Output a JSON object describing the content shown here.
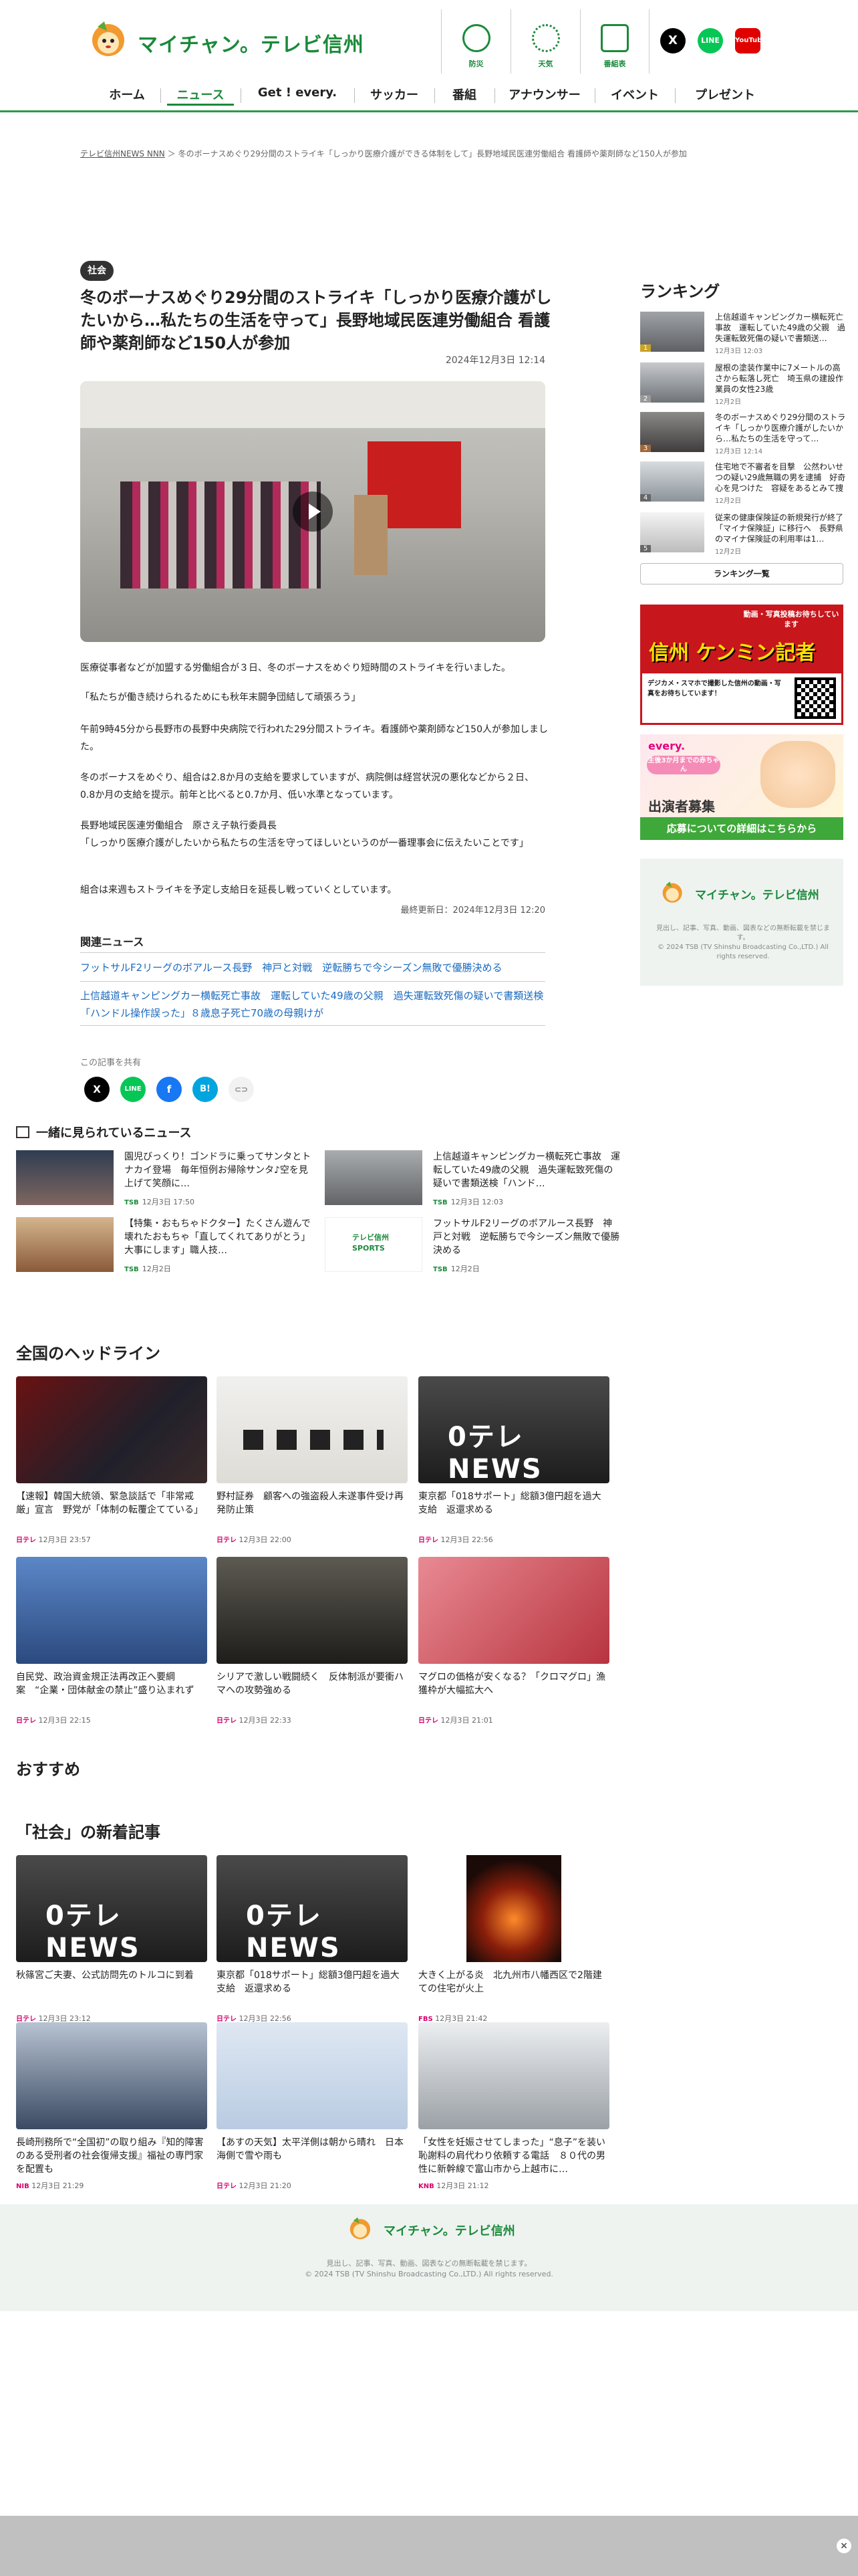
{
  "header": {
    "logo_text": "マイチャン。テレビ信州",
    "icon_buttons": [
      {
        "label": "防災",
        "icon": "umbrella-icon"
      },
      {
        "label": "天気",
        "icon": "sun-icon"
      },
      {
        "label": "番組表",
        "icon": "grid-icon"
      }
    ],
    "social": [
      {
        "label": "X",
        "icon": "x-icon",
        "color": "#000000"
      },
      {
        "label": "LINE",
        "icon": "line-icon",
        "color": "#06c755"
      },
      {
        "label": "YouTube",
        "icon": "youtube-icon",
        "color": "#e00000"
      }
    ],
    "nav": [
      "ホーム",
      "ニュース",
      "Get ! every.",
      "サッカー",
      "番組",
      "アナウンサー",
      "イベント",
      "プレゼント"
    ],
    "nav_active": "ニュース",
    "brand_color": "#1a8a3a"
  },
  "breadcrumb": {
    "home": "テレビ信州NEWS NNN",
    "sep": "＞",
    "current": "冬のボーナスめぐり29分間のストライキ「しっかり医療介護ができる体制をして」長野地域民医連労働組合 看護師や薬剤師など150人が参加"
  },
  "article": {
    "category": "社会",
    "title": "冬のボーナスめぐり29分間のストライキ「しっかり医療介護がしたいから…私たちの生活を守って」長野地域民医連労働組合 看護師や薬剤師など150人が参加",
    "date": "2024年12月3日 12:14",
    "paragraphs": [
      "医療従事者などが加盟する労働組合が３日、冬のボーナスをめぐり短時間のストライキを行いました。",
      "「私たちが働き続けられるためにも秋年末闘争団結して頑張ろう」",
      "午前9時45分から長野市の長野中央病院で行われた29分間ストライキ。看護師や薬剤師など150人が参加しました。",
      "冬のボーナスをめぐり、組合は2.8か月の支給を要求していますが、病院側は経営状況の悪化などから２日、0.8か月の支給を提示。前年と比べると0.7か月、低い水準となっています。",
      "長野地域民医連労働組合　原さえ子執行委員長\n「しっかり医療介護がしたいから私たちの生活を守ってほしいというのが一番理事会に伝えたいことです」",
      "組合は来週もストライキを予定し支給日を延長し戦っていくとしています。"
    ],
    "updated": "最終更新日：2024年12月3日 12:20",
    "related_title": "関連ニュース",
    "related": [
      "フットサルF2リーグのボアルース長野　神戸と対戦　逆転勝ちで今シーズン無敗で優勝決める",
      "上信越道キャンピングカー横転死亡事故　運転していた49歳の父親　過失運転致死傷の疑いで書類送検「ハンドル操作誤った」８歳息子死亡70歳の母親けが"
    ],
    "share_title": "この記事を共有",
    "share": [
      {
        "label": "X",
        "icon": "x-icon",
        "color": "#000000"
      },
      {
        "label": "LINE",
        "icon": "line-icon",
        "color": "#06c755"
      },
      {
        "label": "f",
        "icon": "facebook-icon",
        "color": "#1877f2"
      },
      {
        "label": "B!",
        "icon": "hatena-icon",
        "color": "#00a4de"
      },
      {
        "label": "⊂⊃",
        "icon": "link-icon",
        "color": "#bbbbbb"
      }
    ]
  },
  "seen_together": {
    "title": "一緒に見られているニュース",
    "items": [
      {
        "title": "園児びっくり！ゴンドラに乗ってサンタとトナカイ登場　毎年恒例お帰除サンタ♪空を見上げて笑顔に…",
        "source": "TSB",
        "time": "12月3日 17:50"
      },
      {
        "title": "上信越道キャンピングカー横転死亡事故　運転していた49歳の父親　過失運転致死傷の疑いで書類送検「ハンド…",
        "source": "TSB",
        "time": "12月3日 12:03"
      },
      {
        "title": "【特集・おもちゃドクター】たくさん遊んで壊れたおもちゃ「直してくれてありがとう」大事にします」職人技…",
        "source": "TSB",
        "time": "12月2日"
      },
      {
        "title": "フットサルF2リーグのボアルース長野　神戸と対戦　逆転勝ちで今シーズン無敗で優勝決める",
        "source": "TSB",
        "time": "12月2日"
      }
    ]
  },
  "national": {
    "title": "全国のヘッドライン",
    "items": [
      {
        "title": "【速報】韓国大統領、緊急談話で「非常戒厳」宣言　野党が「体制の転覆企てている」",
        "source": "日テレ",
        "time": "12月3日 23:57",
        "thumb": "photo"
      },
      {
        "title": "野村証券　顧客への強盗殺人未遂事件受け再発防止策",
        "source": "日テレ",
        "time": "12月3日 22:00",
        "thumb": "photo"
      },
      {
        "title": "東京都「018サポート」総額3億円超を過大支給　返還求める",
        "source": "日テレ",
        "time": "12月3日 22:56",
        "thumb": "ntv"
      },
      {
        "title": "自民党、政治資金規正法再改正へ要綱案　“企業・団体献金の禁止”盛り込まれず",
        "source": "日テレ",
        "time": "12月3日 22:15",
        "thumb": "photo"
      },
      {
        "title": "シリアで激しい戦闘続く　反体制派が要衝ハマへの攻勢強める",
        "source": "日テレ",
        "time": "12月3日 22:33",
        "thumb": "photo"
      },
      {
        "title": "マグロの価格が安くなる？「クロマグロ」漁獲枠が大幅拡大へ",
        "source": "日テレ",
        "time": "12月3日 21:01",
        "thumb": "photo"
      }
    ]
  },
  "recommend": {
    "title": "おすすめ"
  },
  "social_news": {
    "title": "「社会」の新着記事",
    "items": [
      {
        "title": "秋篠宮ご夫妻、公式訪問先のトルコに到着",
        "source": "日テレ",
        "time": "12月3日 23:12",
        "thumb": "ntv"
      },
      {
        "title": "東京都「018サポート」総額3億円超を過大支給　返還求める",
        "source": "日テレ",
        "time": "12月3日 22:56",
        "thumb": "ntv"
      },
      {
        "title": "大きく上がる炎　北九州市八幡西区で2階建ての住宅が火上",
        "source": "FBS",
        "time": "12月3日 21:42",
        "thumb": "photo"
      },
      {
        "title": "長崎刑務所で“全国初”の取り組み『知的障害のある受刑者の社会復帰支援』福祉の専門家を配置も",
        "source": "NIB",
        "time": "12月3日 21:29",
        "thumb": "photo"
      },
      {
        "title": "【あすの天気】太平洋側は朝から晴れ　日本海側で雪や雨も",
        "source": "日テレ",
        "time": "12月3日 21:20",
        "thumb": "photo"
      },
      {
        "title": "「女性を妊娠させてしまった」“息子”を装い恥謝料の肩代わり依頼する電話　８０代の男性に新幹線で富山市から上越市に…",
        "source": "KNB",
        "time": "12月3日 21:12",
        "thumb": "photo"
      }
    ]
  },
  "ranking": {
    "title": "ランキング",
    "items": [
      {
        "rank": "1",
        "title": "上信越道キャンピングカー横転死亡事故　運転していた49歳の父親　過失運転致死傷の疑いで書類送…",
        "time": "12月3日 12:03"
      },
      {
        "rank": "2",
        "title": "屋根の塗装作業中に7メートルの高さから転落し死亡　埼玉県の建設作業員の女性23歳",
        "time": "12月2日"
      },
      {
        "rank": "3",
        "title": "冬のボーナスめぐり29分間のストライキ「しっかり医療介護がしたいから…私たちの生活を守って…",
        "time": "12月3日 12:14"
      },
      {
        "rank": "4",
        "title": "住宅地で不審者を目撃　公然わいせつの疑い29歳無職の男を逮捕　好奇心を見つけた　容疑をあるとみて捜査",
        "time": "12月2日"
      },
      {
        "rank": "5",
        "title": "従来の健康保険証の新規発行が終了「マイナ保険証」に移行へ　長野県のマイナ保険証の利用率は1…",
        "time": "12月2日"
      }
    ],
    "list_button": "ランキング一覧"
  },
  "banners": {
    "reporter_top": "動画・写真投稿お待ちしています",
    "reporter_name": "信州 ケンミン記者",
    "reporter_sub": "デジカメ・スマホで撮影した信州の動画・写真をお待ちしています！",
    "every_line1": "生後3か月までの赤ちゃん",
    "every_line2": "出演者募集",
    "every_button": "応募についての詳細はこちらから",
    "logo_text": "マイチャン。テレビ信州",
    "logo_note": "見出し、記事、写真、動画、図表などの無断転載を禁じます。",
    "copyright": "© 2024 TSB (TV Shinshu Broadcasting Co.,LTD.) All rights reserved."
  },
  "footer": {
    "logo_text": "マイチャン。テレビ信州",
    "note": "見出し、記事、写真、動画、図表などの無断転載を禁じます。",
    "copyright": "© 2024 TSB (TV Shinshu Broadcasting Co.,LTD.) All rights reserved."
  },
  "ad": {
    "close_icon": "close-icon"
  }
}
